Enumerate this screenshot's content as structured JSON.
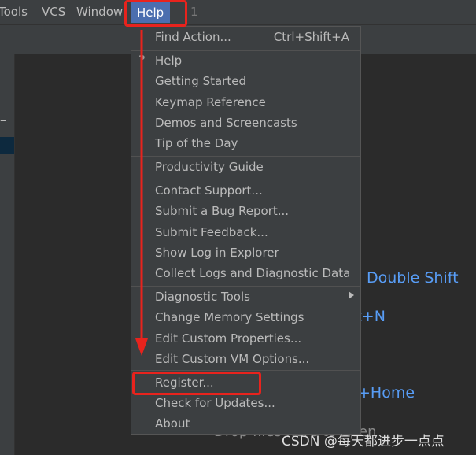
{
  "menubar": {
    "items": [
      "Tools",
      "VCS",
      "Window",
      "Help",
      "1"
    ]
  },
  "hints": [
    "Double Shift",
    "ft+N",
    "+Home"
  ],
  "drop_text": "Drop files here to open",
  "menu": {
    "find_action": {
      "label": "Find Action...",
      "shortcut": "Ctrl+Shift+A"
    },
    "items": [
      "Help",
      "Getting Started",
      "Keymap Reference",
      "Demos and Screencasts",
      "Tip of the Day",
      "Productivity Guide",
      "Contact Support...",
      "Submit a Bug Report...",
      "Submit Feedback...",
      "Show Log in Explorer",
      "Collect Logs and Diagnostic Data",
      "Diagnostic Tools",
      "Change Memory Settings",
      "Edit Custom Properties...",
      "Edit Custom VM Options...",
      "Register...",
      "Check for Updates...",
      "About"
    ]
  },
  "watermark": "CSDN @每天都进步一点点",
  "colors": {
    "accent": "#4b6eaf",
    "annotation": "#e8231d",
    "hint": "#589df6"
  }
}
